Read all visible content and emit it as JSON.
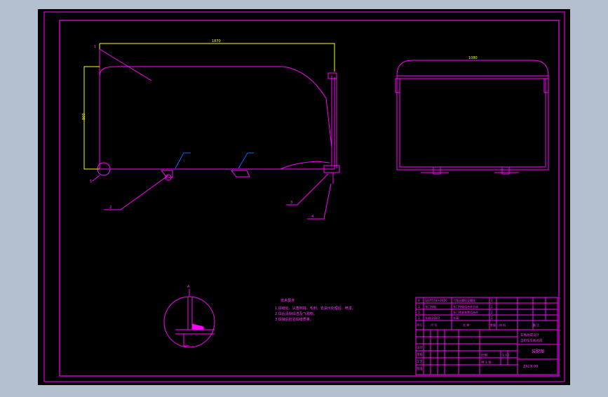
{
  "colors": {
    "background": "#b4c0cf",
    "canvas": "#000000",
    "frame": "#ff00ff",
    "dimension": "#ffff00",
    "leader": "#0066ff",
    "text": "#ff33ff"
  },
  "part_labels": [
    "1",
    "2",
    "3",
    "4",
    "5"
  ],
  "dimensions": {
    "top_width": "1870",
    "left_height": "800",
    "side_width": "1080"
  },
  "detail_mark": "A",
  "notes": {
    "title": "技术要求",
    "lines": [
      "1.焊缝处、尖角倒钝、毛刺、去油污处理后、喷漆。",
      "2.焊后清除焊渣及飞溅物。",
      "3.焊接后检验焊缝质量。"
    ]
  },
  "bom": {
    "rows": [
      [
        "4",
        "GB/T5783-2000",
        "六角头螺栓全螺纹",
        "1",
        "",
        ""
      ],
      [
        "3",
        "车门铰链",
        "车门铰链组合件总成",
        "2",
        "",
        ""
      ],
      [
        "2",
        "",
        "车门锁紧装置组合件",
        "2",
        "",
        ""
      ],
      [
        "1",
        "车厢(1600)",
        "车厢",
        "1",
        "",
        ""
      ]
    ],
    "header": [
      "序号",
      "代 号",
      "名 称",
      "数量",
      "材 料",
      "备 注"
    ]
  },
  "title_block": {
    "project": "车厢总成设计",
    "subtitle": "自卸车车厢总成",
    "drawing_name": "装配图",
    "drawing_no": "ZXCX-00",
    "scale_label": "比例",
    "scale": "1:10",
    "sheet": "共 1 张",
    "roles": [
      "设计",
      "审核",
      "工艺",
      "批准"
    ]
  }
}
